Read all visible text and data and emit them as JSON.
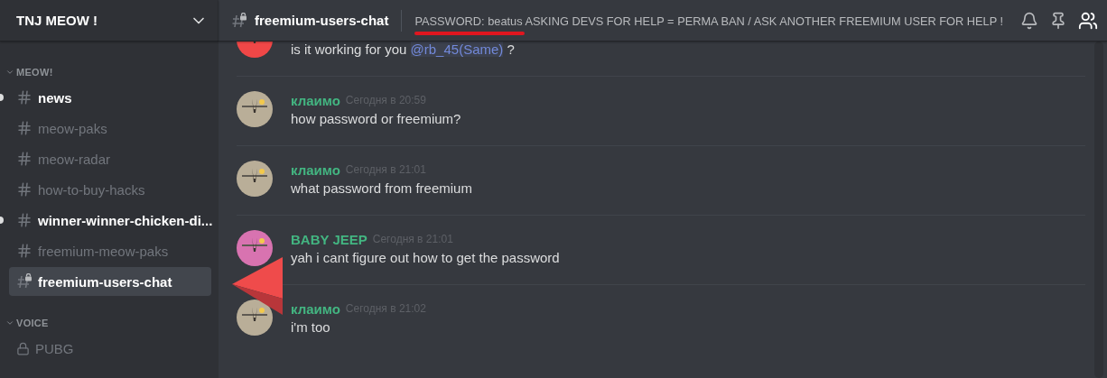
{
  "server": {
    "name": "TNJ MEOW !"
  },
  "categories": [
    {
      "name": "MEOW!",
      "expanded": true,
      "channels": [
        {
          "name": "news",
          "kind": "text",
          "unread": true,
          "selected": false
        },
        {
          "name": "meow-paks",
          "kind": "text",
          "unread": false,
          "selected": false
        },
        {
          "name": "meow-radar",
          "kind": "text",
          "unread": false,
          "selected": false
        },
        {
          "name": "how-to-buy-hacks",
          "kind": "text",
          "unread": false,
          "selected": false
        },
        {
          "name": "winner-winner-chicken-di...",
          "kind": "text",
          "unread": true,
          "selected": false
        },
        {
          "name": "freemium-meow-paks",
          "kind": "text",
          "unread": false,
          "selected": false
        },
        {
          "name": "freemium-users-chat",
          "kind": "locked-text",
          "unread": false,
          "selected": true
        }
      ]
    },
    {
      "name": "VOICE",
      "expanded": true,
      "channels": [
        {
          "name": "PUBG",
          "kind": "locked-voice",
          "unread": false,
          "selected": false
        }
      ]
    }
  ],
  "header": {
    "channel": "freemium-users-chat",
    "topic": "PASSWORD: beatus ASKING DEVS FOR HELP = PERMA BAN / ASK ANOTHER FREEMIUM USER FOR HELP !",
    "underlined": true
  },
  "messages": [
    {
      "avatar": {
        "kind": "picture",
        "color": "#f04747"
      },
      "parts": [
        {
          "text": "is it working for you ",
          "kind": "plain"
        },
        {
          "text": "@rb_45(Same)",
          "kind": "mention"
        },
        {
          "text": " ?",
          "kind": "plain"
        }
      ]
    },
    {
      "author": "клаимо",
      "time": "Сегодня в 20:59",
      "avatar": {
        "kind": "picture",
        "color": "#b9ae98"
      },
      "parts": [
        {
          "text": "how password or freemium?",
          "kind": "plain"
        }
      ]
    },
    {
      "author": "клаимо",
      "time": "Сегодня в 21:01",
      "avatar": {
        "kind": "picture",
        "color": "#b9ae98"
      },
      "parts": [
        {
          "text": "what password from freemium",
          "kind": "plain"
        }
      ]
    },
    {
      "author": "BABY JEEP",
      "time": "Сегодня в 21:01",
      "avatar": {
        "kind": "picture",
        "color": "#d873b0"
      },
      "parts": [
        {
          "text": "yah i cant figure out how to get the password",
          "kind": "plain"
        }
      ]
    },
    {
      "author": "клаимо",
      "time": "Сегодня в 21:02",
      "avatar": {
        "kind": "picture",
        "color": "#b9ae98"
      },
      "parts": [
        {
          "text": "i'm too",
          "kind": "plain"
        }
      ]
    }
  ],
  "pointer_arrow": true
}
